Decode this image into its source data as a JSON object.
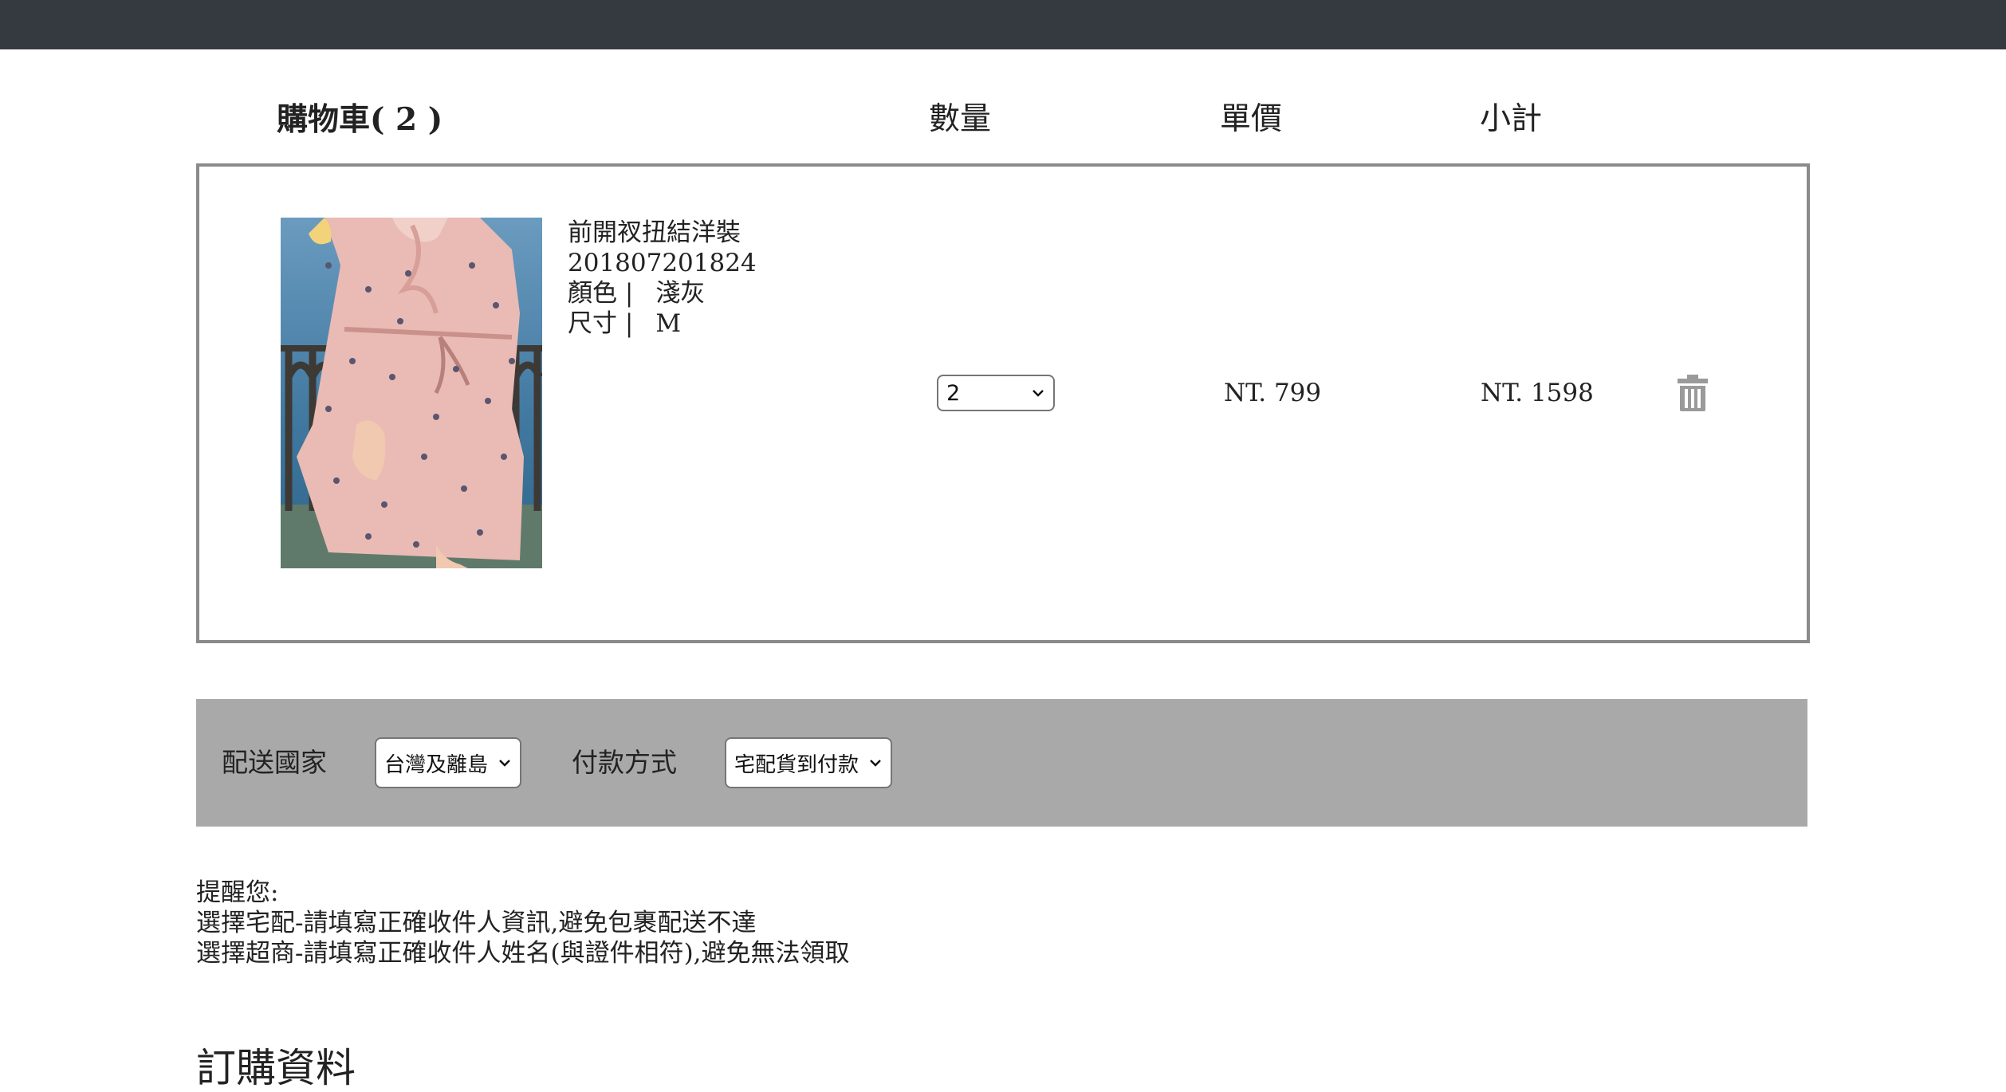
{
  "header": {
    "cart_title": "購物車( 2 )",
    "col_quantity": "數量",
    "col_unit_price": "單價",
    "col_subtotal": "小計"
  },
  "cart_items": [
    {
      "name": "前開衩扭結洋裝",
      "code": "201807201824",
      "color_label": "顏色 |",
      "color_value": "淺灰",
      "size_label": "尺寸 |",
      "size_value": "M",
      "quantity": "2",
      "unit_price": "NT. 799",
      "subtotal": "NT. 1598",
      "delete_icon": "trash-icon"
    }
  ],
  "shipping": {
    "country_label": "配送國家",
    "country_value": "台灣及離島",
    "payment_label": "付款方式",
    "payment_value": "宅配貨到付款"
  },
  "notice": {
    "title": "提醒您:",
    "line1": "選擇宅配-請填寫正確收件人資訊,避免包裹配送不達",
    "line2": "選擇超商-請填寫正確收件人姓名(與證件相符),避免無法領取"
  },
  "order_section_title": "訂購資料",
  "colors": {
    "topbar": "#343a40",
    "shipbar": "#a9a9a9",
    "cart_border": "#8a8a8a",
    "icon_gray": "#9a9a9a"
  }
}
